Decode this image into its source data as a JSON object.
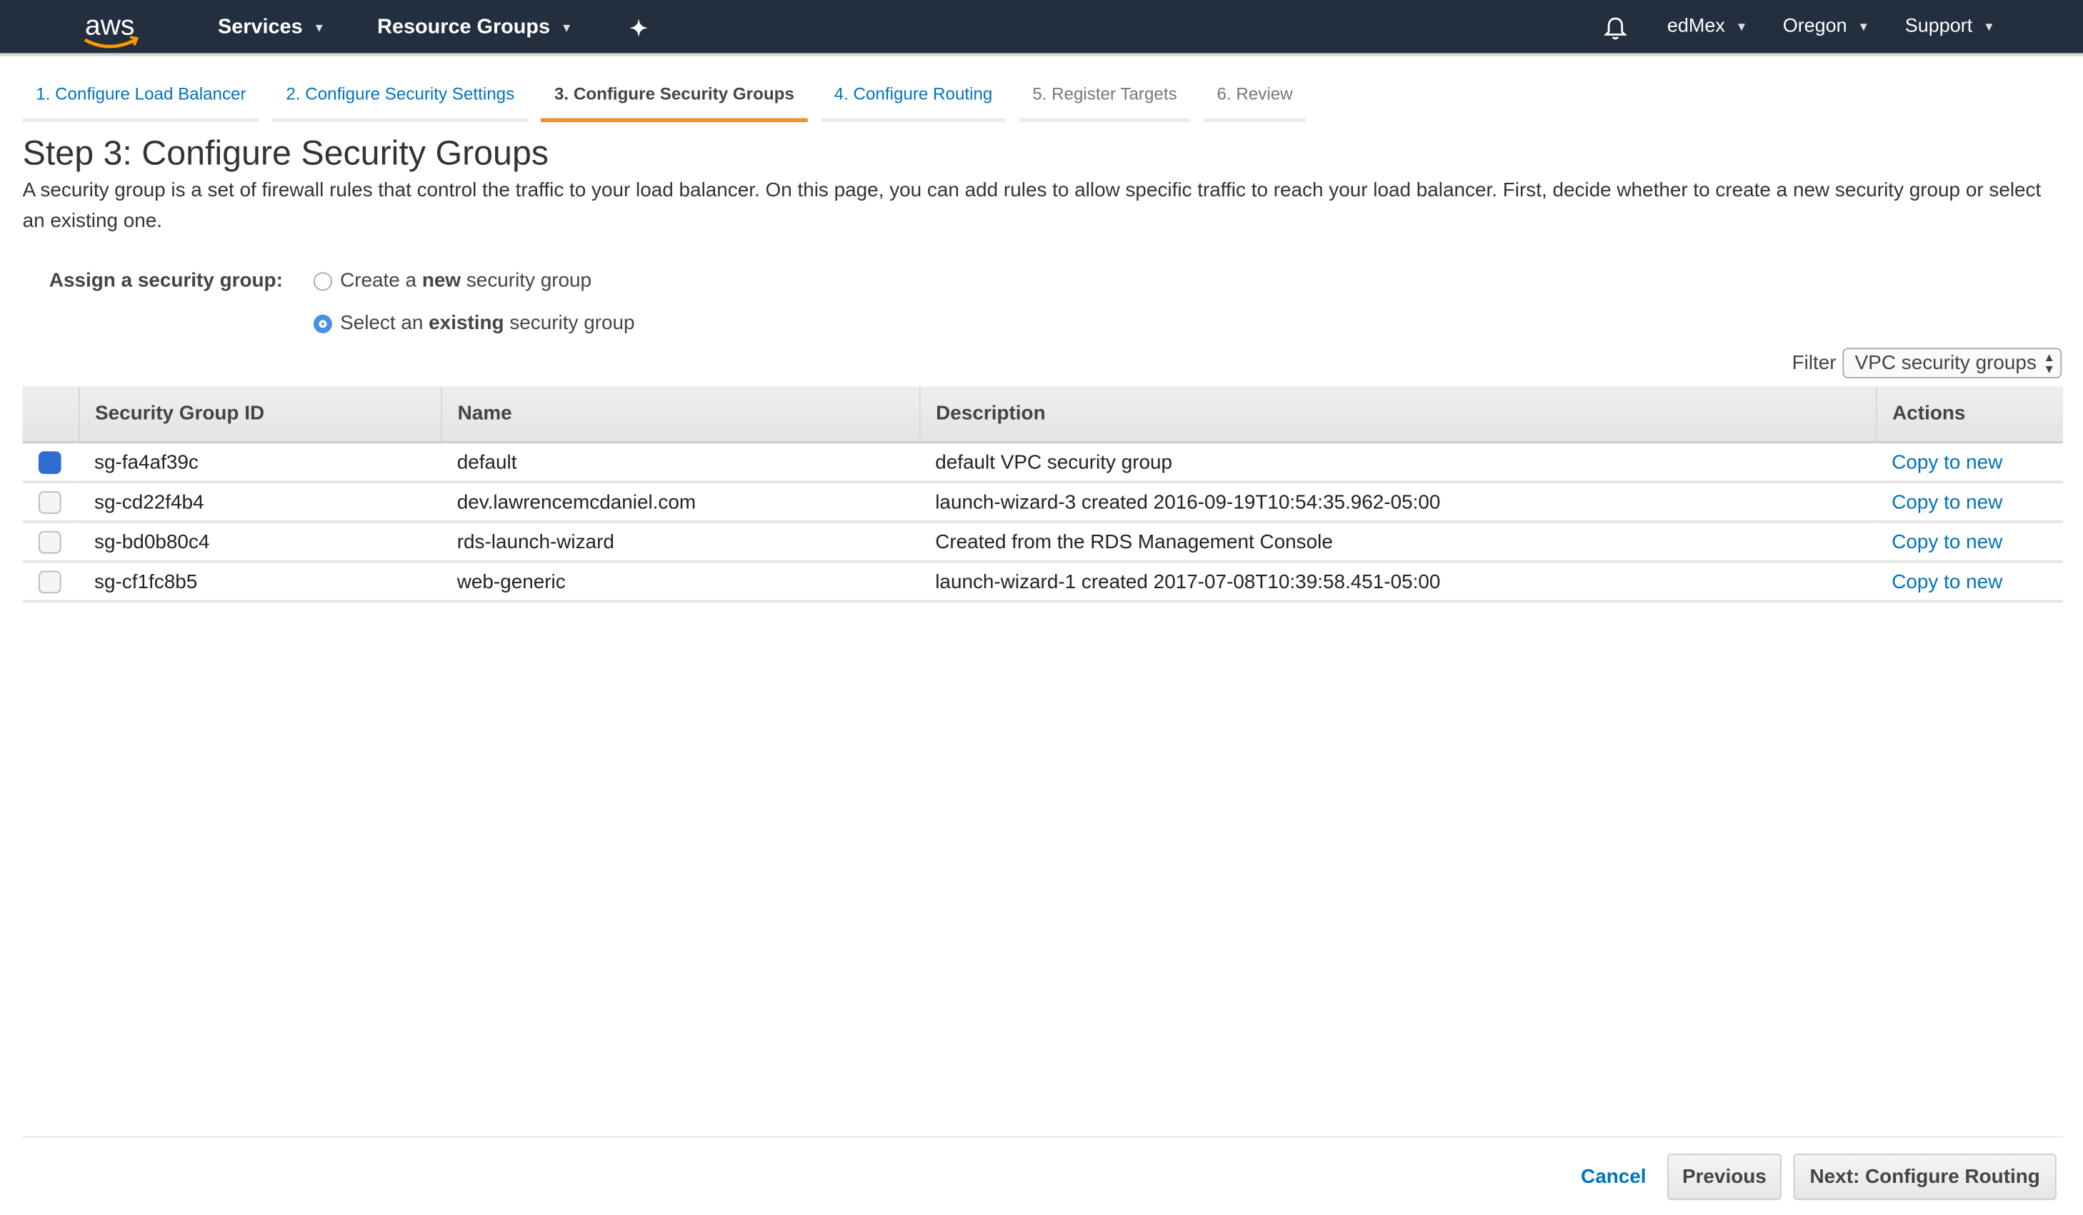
{
  "topbar": {
    "logo": "aws",
    "services": "Services",
    "resource_groups": "Resource Groups",
    "user": "edMex",
    "region": "Oregon",
    "support": "Support"
  },
  "steps": [
    {
      "label": "1. Configure Load Balancer",
      "state": "link"
    },
    {
      "label": "2. Configure Security Settings",
      "state": "link"
    },
    {
      "label": "3. Configure Security Groups",
      "state": "active"
    },
    {
      "label": "4. Configure Routing",
      "state": "link"
    },
    {
      "label": "5. Register Targets",
      "state": "disabled"
    },
    {
      "label": "6. Review",
      "state": "disabled"
    }
  ],
  "page": {
    "title": "Step 3: Configure Security Groups",
    "description": "A security group is a set of firewall rules that control the traffic to your load balancer. On this page, you can add rules to allow specific traffic to reach your load balancer. First, decide whether to create a new security group or select an existing one."
  },
  "assign": {
    "label": "Assign a security group:",
    "option_new": {
      "pre": "Create a ",
      "bold": "new",
      "post": " security group",
      "selected": false
    },
    "option_existing": {
      "pre": "Select an ",
      "bold": "existing",
      "post": " security group",
      "selected": true
    }
  },
  "filter": {
    "label": "Filter",
    "value": "VPC security groups"
  },
  "table": {
    "headers": [
      "Security Group ID",
      "Name",
      "Description",
      "Actions"
    ],
    "rows": [
      {
        "id": "sg-fa4af39c",
        "name": "default",
        "description": "default VPC security group",
        "action": "Copy to new",
        "checked": true
      },
      {
        "id": "sg-cd22f4b4",
        "name": "dev.lawrencemcdaniel.com",
        "description": "launch-wizard-3 created 2016-09-19T10:54:35.962-05:00",
        "action": "Copy to new",
        "checked": false
      },
      {
        "id": "sg-bd0b80c4",
        "name": "rds-launch-wizard",
        "description": "Created from the RDS Management Console",
        "action": "Copy to new",
        "checked": false
      },
      {
        "id": "sg-cf1fc8b5",
        "name": "web-generic",
        "description": "launch-wizard-1 created 2017-07-08T10:39:58.451-05:00",
        "action": "Copy to new",
        "checked": false
      }
    ]
  },
  "footer": {
    "cancel": "Cancel",
    "previous": "Previous",
    "next": "Next: Configure Routing"
  },
  "colors": {
    "topbar": "#232f3e",
    "link": "#0073bb",
    "active_step": "#ec912d",
    "checkbox_on": "#2e6ccf"
  }
}
